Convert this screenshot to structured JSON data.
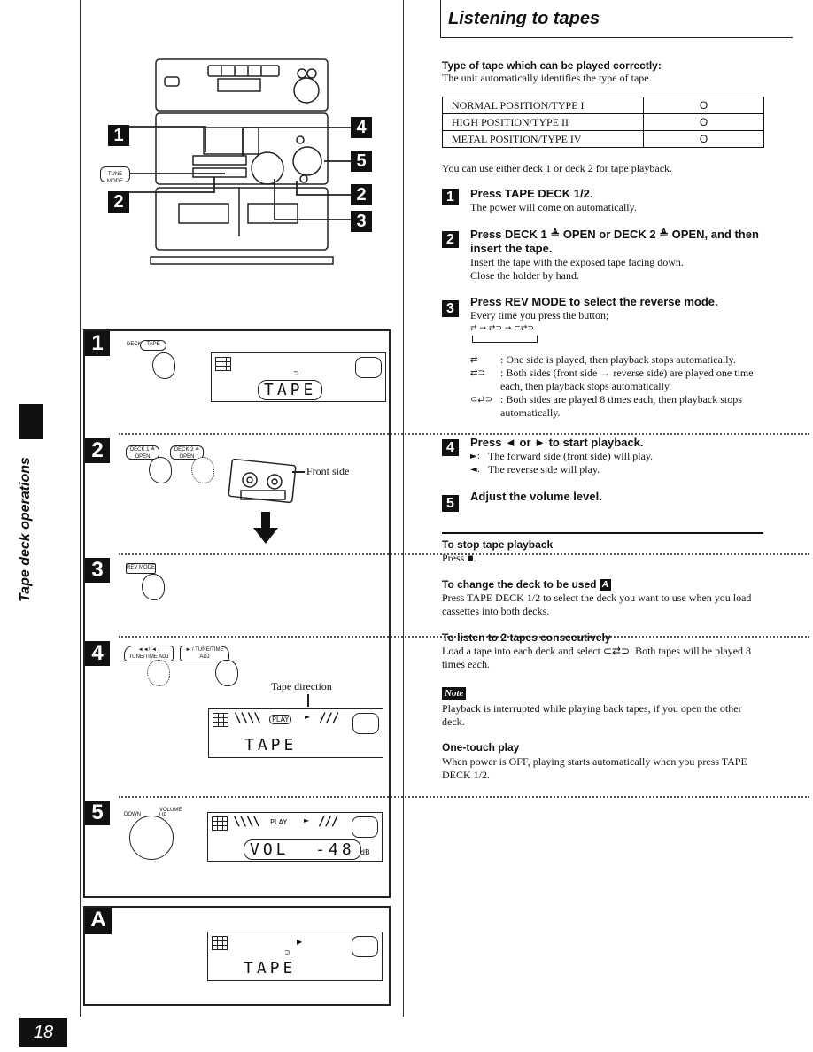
{
  "side_tab": {
    "label": "Tape deck operations"
  },
  "page_number": "18",
  "header": {
    "title": "Listening to tapes"
  },
  "tape_types": {
    "heading": "Type of tape which can be played correctly:",
    "intro": "The unit automatically identifies the type of tape.",
    "rows": [
      {
        "type": "NORMAL POSITION/TYPE I",
        "supported": "O"
      },
      {
        "type": "HIGH POSITION/TYPE II",
        "supported": "O"
      },
      {
        "type": "METAL POSITION/TYPE IV",
        "supported": "O"
      }
    ],
    "deck_note": "You can use either deck 1 or deck 2 for tape playback."
  },
  "steps": [
    {
      "num": "1",
      "heading": "Press TAPE DECK 1/2.",
      "body": [
        "The power will come on automatically."
      ]
    },
    {
      "num": "2",
      "heading": "Press DECK 1 ≜ OPEN or DECK 2 ≜ OPEN, and then insert the tape.",
      "body": [
        "Insert the tape with the exposed tape facing down.",
        "Close the holder by hand."
      ]
    },
    {
      "num": "3",
      "heading": "Press REV MODE to select the reverse mode.",
      "body": [
        "Every time you press the button;"
      ],
      "sequence": "⇄ → ⇄⊃ → ⊂⇄⊃",
      "modes": [
        {
          "symbol": "⇄",
          "desc": ": One side is played, then playback stops automatically."
        },
        {
          "symbol": "⇄⊃",
          "desc": ": Both sides (front side → reverse side) are played one time each, then playback stops automatically."
        },
        {
          "symbol": "⊂⇄⊃",
          "desc": ": Both sides are played 8 times each, then playback stops automatically."
        }
      ]
    },
    {
      "num": "4",
      "heading": "Press ◄ or ► to start playback.",
      "options": [
        {
          "symbol": "►:",
          "desc": "The forward side (front side) will play."
        },
        {
          "symbol": "◄:",
          "desc": "The reverse side will play."
        }
      ]
    },
    {
      "num": "5",
      "heading": "Adjust the volume level."
    }
  ],
  "tips": [
    {
      "heading": "To stop tape playback",
      "body": "Press ■."
    },
    {
      "heading": "To change the deck to be used",
      "badge": "A",
      "body": "Press TAPE DECK 1/2 to select the deck you want to use when you load cassettes into both decks."
    },
    {
      "heading": "To listen to 2 tapes consecutively",
      "body": "Load a tape into each deck and select ⊂⇄⊃. Both tapes will be played 8 times each."
    }
  ],
  "note": {
    "badge": "Note",
    "body": "Playback is interrupted while playing back tapes, if you open the other deck."
  },
  "one_touch": {
    "heading": "One-touch play",
    "body": "When power is OFF, playing starts automatically when you press TAPE DECK 1/2."
  },
  "illustration": {
    "callouts": [
      "1",
      "2",
      "4",
      "5",
      "2",
      "3"
    ],
    "tune_mode_label": "TUNE MODE",
    "panel_steps": [
      "1",
      "2",
      "3",
      "4",
      "5"
    ],
    "panel_a_label": "A",
    "deck_button_label": "DECK 1/2",
    "tape_button_label": "TAPE",
    "deck1_open_label": "DECK 1 ≜ OPEN",
    "deck2_open_label": "DECK 2 ≜ OPEN",
    "front_side_label": "Front side",
    "rev_mode_label": "REV MODE",
    "rew_button_label": "◄◄/ ◄ / TUNE/TIME ADJ",
    "ff_button_label": "► / TUNE/TIME ADJ",
    "tape_direction_label": "Tape direction",
    "volume_down_label": "DOWN",
    "volume_up_label": "VOLUME UP",
    "display_step1": "TAPE",
    "display_step4": "TAPE",
    "display_step5": "VOL  -48",
    "display_step5_unit": "dB",
    "display_a": "TAPE"
  }
}
